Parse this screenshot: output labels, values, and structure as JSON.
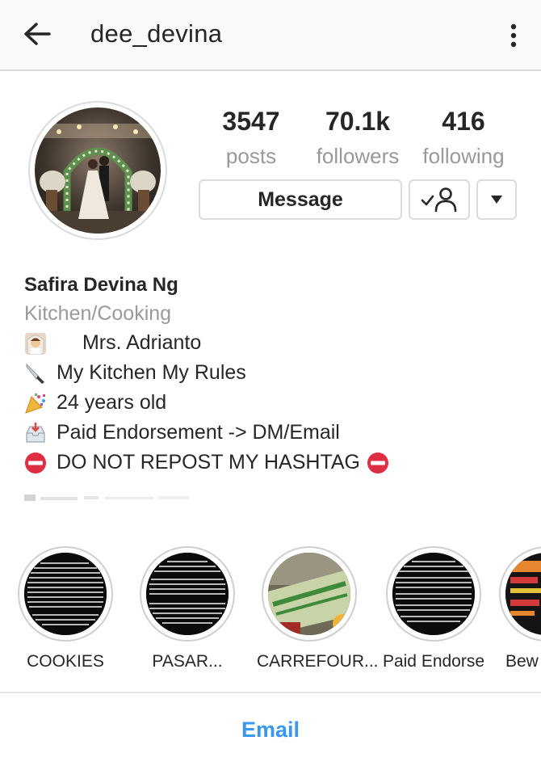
{
  "header": {
    "username": "dee_devina",
    "back_icon": "arrow-left-icon",
    "more_icon": "more-vertical-icon"
  },
  "stats": {
    "posts": {
      "value": "3547",
      "label": "posts"
    },
    "followers": {
      "value": "70.1k",
      "label": "followers"
    },
    "following": {
      "value": "416",
      "label": "following"
    }
  },
  "actions": {
    "message_label": "Message",
    "follow_icon": "person-check-icon",
    "dropdown_icon": "triangle-down-icon"
  },
  "bio": {
    "name": "Safira Devina Ng",
    "category": "Kitchen/Cooking",
    "lines": [
      {
        "icon": "bride-emoji",
        "text": "  Mrs. Adrianto"
      },
      {
        "icon": "knife-emoji",
        "text": "My Kitchen My Rules"
      },
      {
        "icon": "party-popper-emoji",
        "text": "24 years old"
      },
      {
        "icon": "inbox-emoji",
        "text": "Paid Endorsement -> DM/Email"
      },
      {
        "icon": "no-entry-emoji",
        "text": "DO NOT REPOST MY HASHTAG",
        "trailing_icon": "no-entry-emoji"
      }
    ]
  },
  "highlights": [
    {
      "label": "COOKIES"
    },
    {
      "label": "PASAR..."
    },
    {
      "label": "CARREFOUR..."
    },
    {
      "label": "Paid Endorse"
    },
    {
      "label": "Bew"
    }
  ],
  "footer": {
    "email_label": "Email"
  },
  "colors": {
    "link_blue": "#3897f0",
    "muted_gray": "#999999",
    "border_gray": "#dbdbdb",
    "no_entry_red": "#dd2e44"
  }
}
